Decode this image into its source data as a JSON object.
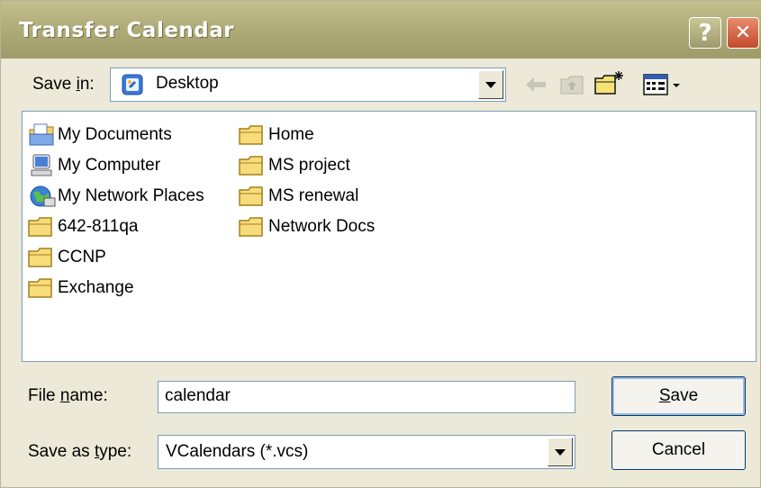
{
  "dialog": {
    "title": "Transfer  Calendar",
    "help_glyph": "?",
    "close_glyph": "✕"
  },
  "save_in": {
    "label_pre": "Save ",
    "label_key": "i",
    "label_post": "n:",
    "location": "Desktop"
  },
  "toolbar": {
    "back_icon": "back-arrow-icon",
    "up_icon": "up-folder-icon",
    "new_folder_icon": "new-folder-icon",
    "views_icon": "views-menu-icon"
  },
  "items": [
    {
      "label": "My Documents",
      "icon": "my-documents-icon"
    },
    {
      "label": "My Computer",
      "icon": "my-computer-icon"
    },
    {
      "label": "My Network Places",
      "icon": "network-places-icon"
    },
    {
      "label": "642-811qa",
      "icon": "folder-icon"
    },
    {
      "label": "CCNP",
      "icon": "folder-icon"
    },
    {
      "label": "Exchange",
      "icon": "folder-icon"
    },
    {
      "label": "Home",
      "icon": "folder-icon"
    },
    {
      "label": "MS project",
      "icon": "folder-icon"
    },
    {
      "label": "MS renewal",
      "icon": "folder-icon"
    },
    {
      "label": "Network Docs",
      "icon": "folder-icon"
    }
  ],
  "file_name": {
    "label_pre": "File ",
    "label_key": "n",
    "label_post": "ame:",
    "value": "calendar"
  },
  "save_as_type": {
    "label_pre": "Save as ",
    "label_key": "t",
    "label_post": "ype:",
    "value": "VCalendars (*.vcs)"
  },
  "buttons": {
    "save_key": "S",
    "save_rest": "ave",
    "cancel": "Cancel"
  }
}
